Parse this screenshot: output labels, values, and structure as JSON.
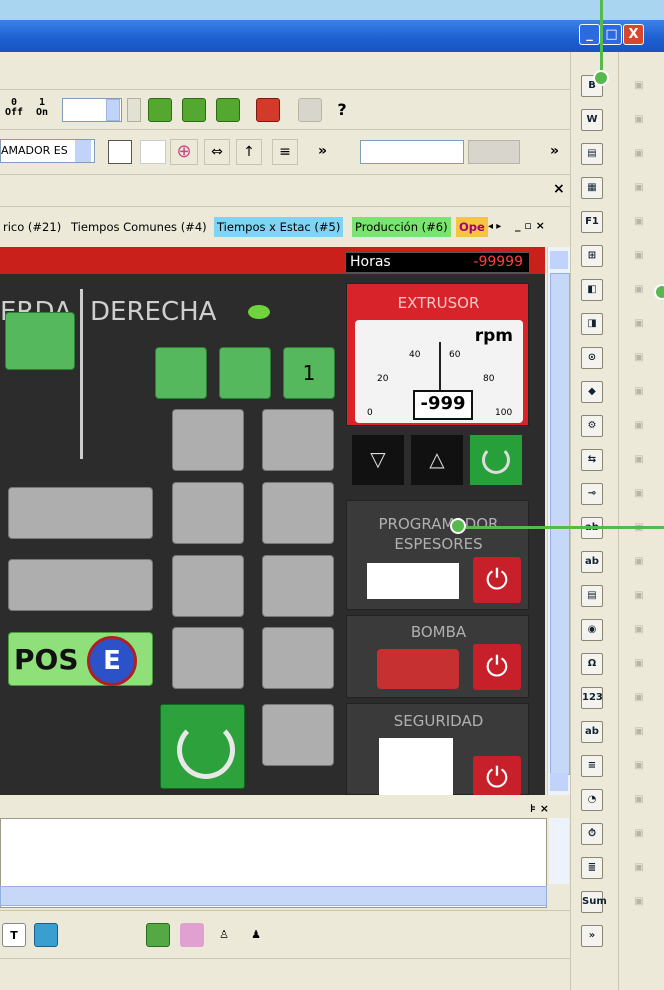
{
  "window": {
    "minimize_label": "_",
    "maximize_label": "□",
    "close_label": "X"
  },
  "toolbar": {
    "off_top": "0",
    "off_bottom": "Off",
    "on_top": "1",
    "on_bottom": "On",
    "help_label": "?",
    "combo_text": "AMADOR ES",
    "more_label": "»"
  },
  "tabs": [
    {
      "label": "rico (#21)",
      "color": "#ffffff"
    },
    {
      "label": "Tiempos Comunes (#4)",
      "color": "#ffffff"
    },
    {
      "label": "Tiempos x Estac (#5)",
      "color": "#7fd4f3"
    },
    {
      "label": "Producción (#6)",
      "color": "#7be36f"
    },
    {
      "label": "Ope",
      "color": "#f5c542"
    }
  ],
  "hmi": {
    "left_header": "ERDA",
    "right_header": "DERECHA",
    "horas_label": "Horas",
    "horas_value": "-99999",
    "pos_label": "POS",
    "pos_letter": "E",
    "extrusor": {
      "title": "EXTRUSOR",
      "unit": "rpm",
      "value": "-999",
      "ticks": [
        "0",
        "20",
        "40",
        "60",
        "80",
        "100"
      ]
    },
    "programador": {
      "line1": "PROGRAMADOR",
      "line2": "ESPESORES"
    },
    "bomba": {
      "title": "BOMBA"
    },
    "seguridad": {
      "title": "SEGURIDAD"
    },
    "down_arrow": "▽",
    "up_arrow": "△"
  },
  "right_toolbar": {
    "icons": [
      "B",
      "W",
      "▤",
      "▦",
      "F1",
      "⊞",
      "◧",
      "◨",
      "⊙",
      "◆",
      "⚙",
      "⇆",
      "⊸",
      "ab",
      "ab",
      "▤",
      "◉",
      "Ω",
      "123",
      "ab",
      "≡",
      "◔",
      "⏱",
      "≣",
      "Sum",
      "»"
    ]
  },
  "colors": {
    "callout": "#57b84e",
    "titlebar": "#1d5fd0",
    "hmi_red": "#c9201b"
  }
}
